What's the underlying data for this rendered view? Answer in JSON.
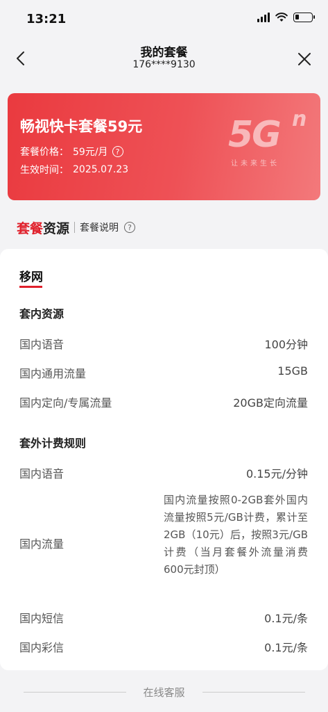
{
  "status_bar": {
    "time": "13:21"
  },
  "nav": {
    "title": "我的套餐",
    "phone": "176****9130"
  },
  "plan_card": {
    "name": "畅视快卡套餐59元",
    "price_label": "套餐价格：",
    "price_value": "59元/月",
    "effective_label": "生效时间：",
    "effective_value": "2025.07.23",
    "logo_main": "5G",
    "logo_sup": "n",
    "logo_tagline": "让未来生长"
  },
  "section_tabs": {
    "active_accent": "套餐",
    "active_rest": "资源",
    "description": "套餐说明"
  },
  "panel": {
    "carrier": "移网",
    "included": {
      "title": "套内资源",
      "rows": [
        {
          "label": "国内语音",
          "value": "100分钟"
        },
        {
          "label": "国内通用流量",
          "value": "15GB"
        },
        {
          "label": "国内定向/专属流量",
          "value": "20GB定向流量"
        }
      ]
    },
    "extra": {
      "title": "套外计费规则",
      "rows": [
        {
          "label": "国内语音",
          "value": "0.15元/分钟"
        },
        {
          "label": "国内流量",
          "value": "国内流量按照0-2GB套外国内流量按照5元/GB计费，累计至2GB（10元）后，按照3元/GB计费（当月套餐外流量消费600元封顶）"
        },
        {
          "label": "国内短信",
          "value": "0.1元/条"
        },
        {
          "label": "国内彩信",
          "value": "0.1元/条"
        }
      ]
    }
  },
  "footer": {
    "service": "在线客服"
  },
  "colors": {
    "accent": "#e0202b",
    "card_start": "#ea3a3f",
    "card_end": "#f3797b"
  }
}
